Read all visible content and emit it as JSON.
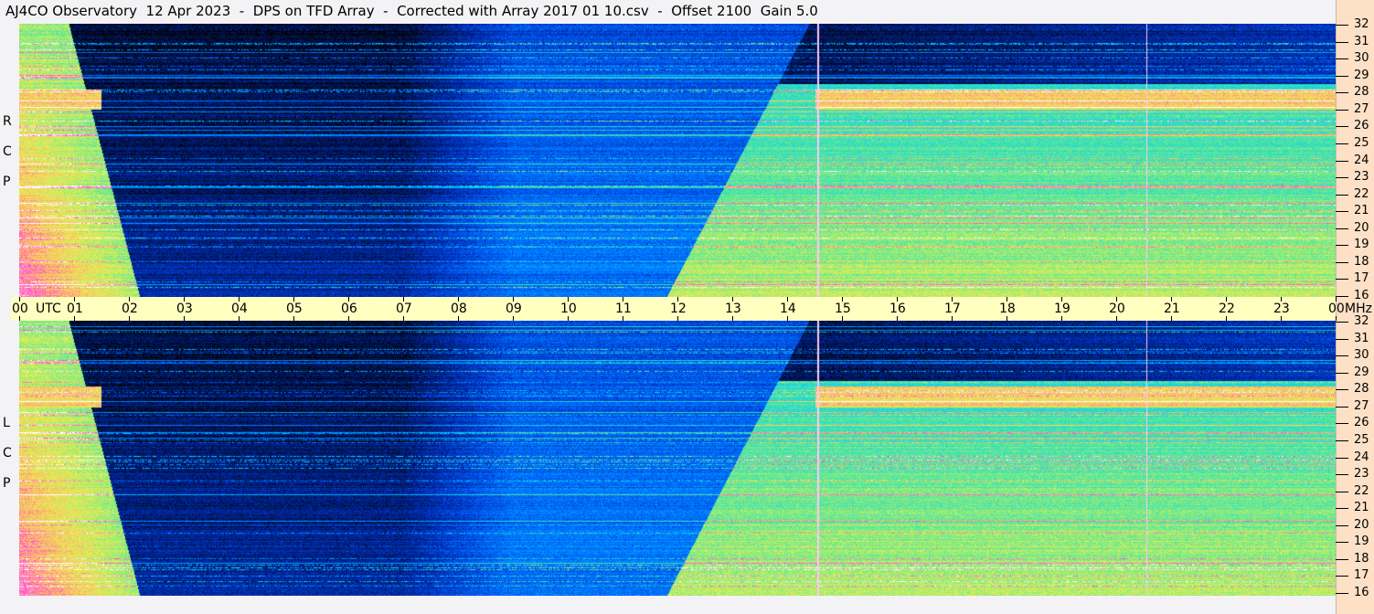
{
  "title": "AJ4CO Observatory  12 Apr 2023  -  DPS on TFD Array  -  Corrected with Array 2017 01 10.csv  -  Offset 2100  Gain 5.0",
  "chart_data": {
    "type": "heatmap",
    "title": "AJ4CO Observatory  12 Apr 2023  -  DPS on TFD Array  -  Corrected with Array 2017 01 10.csv  -  Offset 2100  Gain 5.0",
    "x_unit_label": "UTC",
    "y_unit_label": "MHz",
    "x_tick_labels": [
      "00",
      "01",
      "02",
      "03",
      "04",
      "05",
      "06",
      "07",
      "08",
      "09",
      "10",
      "11",
      "12",
      "13",
      "14",
      "15",
      "16",
      "17",
      "18",
      "19",
      "20",
      "21",
      "22",
      "23",
      "00"
    ],
    "y_tick_labels": [
      "32",
      "31",
      "30",
      "29",
      "28",
      "27",
      "26",
      "25",
      "24",
      "23",
      "22",
      "21",
      "20",
      "19",
      "18",
      "17",
      "16"
    ],
    "xlim": [
      0,
      24
    ],
    "ylim": [
      16,
      32
    ],
    "panels": [
      {
        "label": [
          "R",
          "C",
          "P"
        ]
      },
      {
        "label": [
          "L",
          "C",
          "P"
        ]
      }
    ],
    "colormap": [
      "#000000",
      "#0030c0",
      "#0070ff",
      "#00c8ff",
      "#50e6a0",
      "#e8f050",
      "#ffb070",
      "#ff40e0",
      "#ffffff"
    ]
  }
}
